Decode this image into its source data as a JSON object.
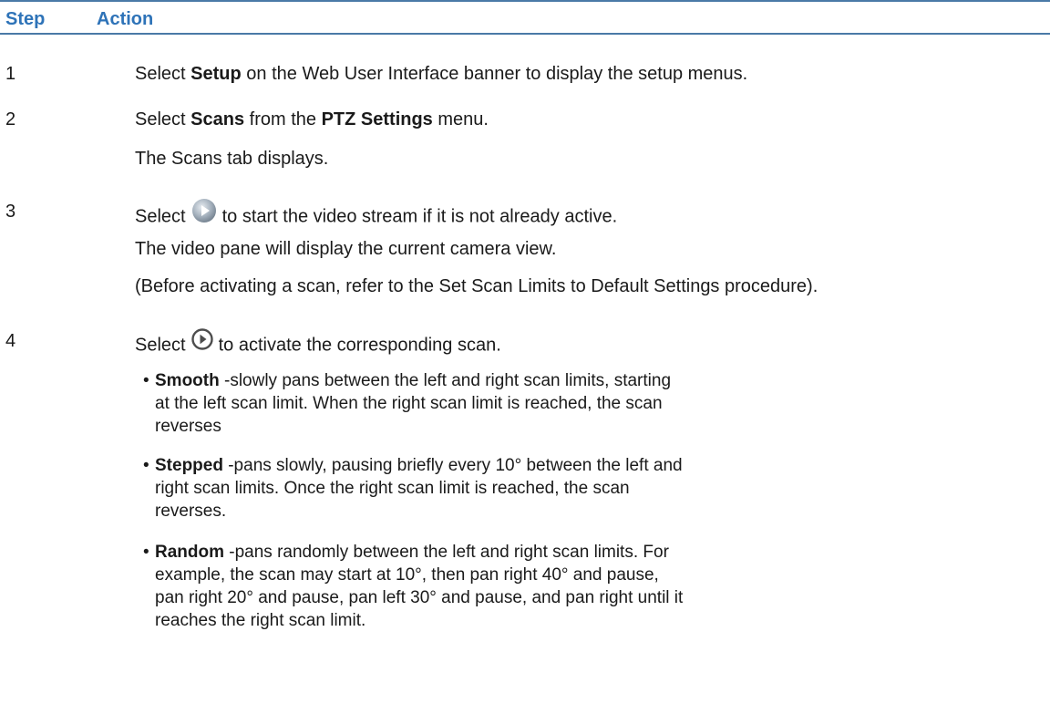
{
  "header": {
    "step_label": "Step",
    "action_label": "Action"
  },
  "steps": [
    {
      "number": "1",
      "pre": "Select ",
      "bold": "Setup",
      "post": " on the Web User Interface banner to display the setup menus."
    },
    {
      "number": "2",
      "pre": "Select ",
      "bold": "Scans",
      "mid": " from the ",
      "bold2": "PTZ Settings",
      "post": " menu.",
      "note": "The Scans tab displays."
    },
    {
      "number": "3",
      "pre": "Select",
      "icon": "play-stream-icon",
      "post": "to start the video stream if it is not already active.",
      "note1": "The video pane will display the current camera view.",
      "note2": "(Before activating a scan, refer to the Set Scan Limits to Default Settings procedure)."
    },
    {
      "number": "4",
      "pre": "Select",
      "icon": "activate-scan-icon",
      "post": "to activate the corresponding scan.",
      "bullets": [
        {
          "term": "Smooth",
          "desc": " -slowly pans between the left and right scan limits, starting at the left scan limit. When the right scan limit is reached, the scan reverses"
        },
        {
          "term": "Stepped",
          "desc": " -pans slowly, pausing briefly every 10° between the left and right scan limits. Once the right scan limit is reached, the scan reverses."
        },
        {
          "term": "Random",
          "desc": " -pans randomly between the left and right scan limits. For example, the scan may start at 10°, then pan right 40° and pause, pan right 20° and pause, pan left 30° and pause, and pan right until it reaches the right scan limit."
        }
      ]
    }
  ],
  "colors": {
    "header_text": "#2e73b8",
    "rule": "#4a7aa7",
    "body_text": "#1a1a1a"
  }
}
